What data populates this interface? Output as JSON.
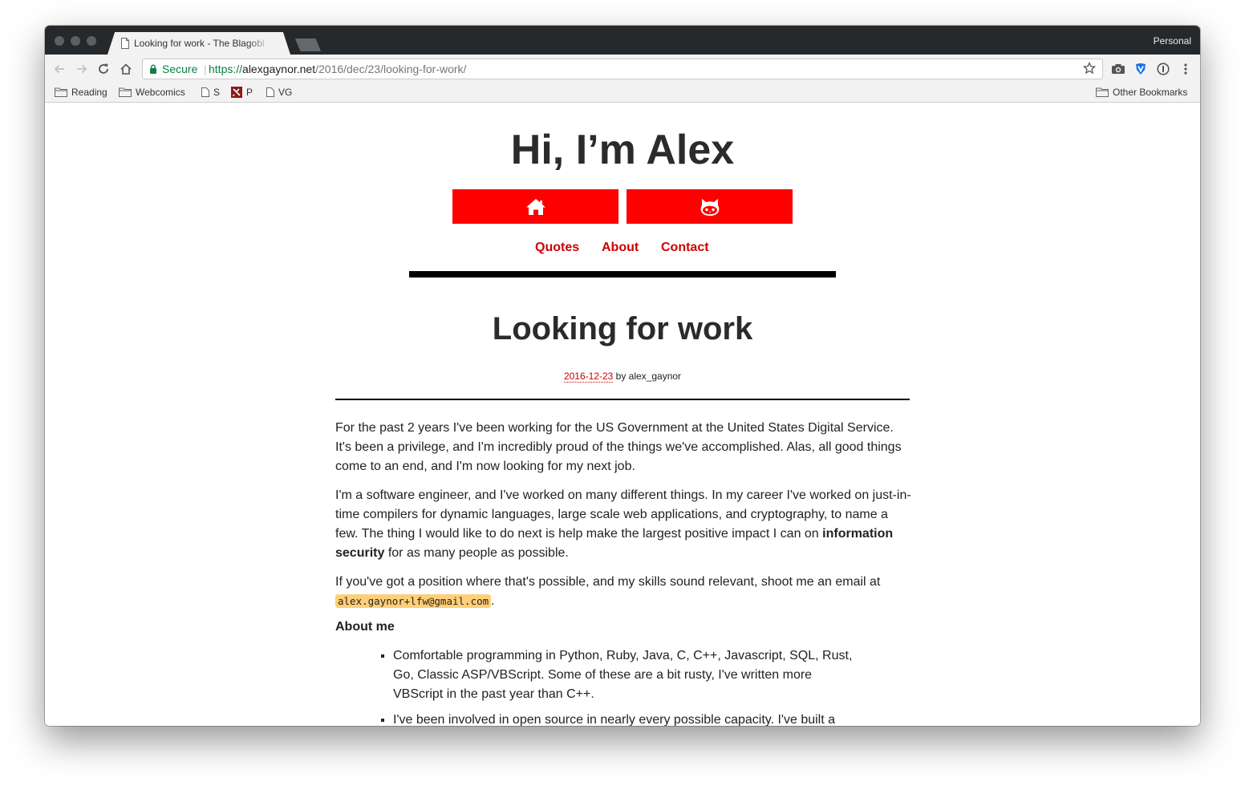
{
  "browser": {
    "tab_title": "Looking for work - The Blagobl",
    "profile": "Personal",
    "omnibox": {
      "secure_label": "Secure",
      "url_scheme": "https://",
      "url_host": "alexgaynor.net",
      "url_path": "/2016/dec/23/looking-for-work/"
    },
    "bookmarks": [
      {
        "label": "Reading",
        "icon": "folder-icon"
      },
      {
        "label": "Webcomics",
        "icon": "folder-icon"
      },
      {
        "label": "S",
        "icon": "page-icon"
      },
      {
        "label": "P",
        "icon": "pin-icon"
      },
      {
        "label": "VG",
        "icon": "page-icon"
      }
    ],
    "other_bookmarks": "Other Bookmarks"
  },
  "site": {
    "title": "Hi, I’m Alex",
    "icon_buttons": [
      "home-icon",
      "github-icon"
    ],
    "nav": [
      "Quotes",
      "About",
      "Contact"
    ]
  },
  "post": {
    "title": "Looking for work",
    "date": "2016-12-23",
    "byline": " by alex_gaynor",
    "p1": "For the past 2 years I've been working for the US Government at the United States Digital Service. It's been a privilege, and I'm incredibly proud of the things we've accomplished. Alas, all good things come to an end, and I'm now looking for my next job.",
    "p2_before": "I'm a software engineer, and I've worked on many different things. In my career I've worked on just-in-time compilers for dynamic languages, large scale web applications, and cryptography, to name a few. The thing I would like to do next is help make the largest positive impact I can on ",
    "p2_bold": "information security",
    "p2_after": " for as many people as possible.",
    "p3_before": "If you've got a position where that's possible, and my skills sound relevant, shoot me an email at ",
    "email": "alex.gaynor+lfw@gmail.com",
    "p3_after": ".",
    "about_heading": "About me",
    "about_items": [
      "Comfortable programming in Python, Ruby, Java, C, C++, Javascript, SQL, Rust, Go, Classic ASP/VBScript. Some of these are a bit rusty, I've written more VBScript in the past year than C++.",
      "I've been involved in open source in nearly every possible capacity. I've built a"
    ]
  },
  "colors": {
    "accent_red": "#ff0000",
    "link_red": "#cc0000",
    "code_highlight": "#ffcf77",
    "secure_green": "#0b8043"
  }
}
